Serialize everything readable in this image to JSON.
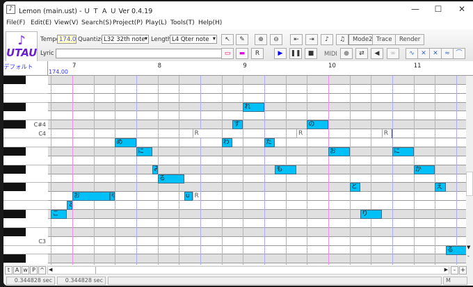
{
  "window": {
    "title": "Lemon (main.ust) - Ｕ Ｔ Ａ Ｕ Ver 0.4.19",
    "minimize": "—",
    "maximize": "☐",
    "close": "✕"
  },
  "menu": [
    "File(F)",
    "Edit(E)",
    "View(V)",
    "Search(S)",
    "Project(P)",
    "Play(L)",
    "Tools(T)",
    "Help(H)"
  ],
  "toolbar": {
    "logo_text": "UTAU",
    "tempo_label": "Tempo",
    "tempo_value": "174.0",
    "quantize_label": "Quantize",
    "quantize_value": "L32 32th note",
    "length_label": "Length",
    "length_value": "L4  Qter note",
    "lyric_label": "Lyric",
    "lyric_value": "",
    "mode2": "Mode2",
    "trace": "Trace",
    "render": "Render",
    "midi_label": "MIDI"
  },
  "track": {
    "name": "デフォルト",
    "tempo": "174.00",
    "measures": [
      "7",
      "8",
      "9",
      "10",
      "11"
    ]
  },
  "key_labels": [
    {
      "row": 5,
      "text": "C#4"
    },
    {
      "row": 6,
      "text": "C4"
    },
    {
      "row": 18,
      "text": "C3"
    }
  ],
  "pitch_rows": [
    "F#4",
    "F4",
    "E4",
    "D#4",
    "D4",
    "C#4",
    "C4",
    "B3",
    "A#3",
    "A3",
    "G#3",
    "G3",
    "F#3",
    "F3",
    "E3",
    "D#3",
    "D3",
    "C#3",
    "C3",
    "B2",
    "A#2"
  ],
  "notes": [
    {
      "lyric": "こ",
      "pitch": "D#3",
      "start": -1,
      "len": 0.75
    },
    {
      "lyric": "と",
      "pitch": "E3",
      "start": -0.25,
      "len": 0.25
    },
    {
      "lyric": "お",
      "pitch": "F3",
      "start": 0,
      "len": 1.75
    },
    {
      "lyric": "ゆ",
      "pitch": "F3",
      "start": 1.75,
      "len": 0.25
    },
    {
      "lyric": "め",
      "pitch": "B3",
      "start": 2,
      "len": 1
    },
    {
      "lyric": "に",
      "pitch": "A#3",
      "start": 3,
      "len": 0.75
    },
    {
      "lyric": "み",
      "pitch": "G#3",
      "start": 3.75,
      "len": 0.25
    },
    {
      "lyric": "る",
      "pitch": "G3",
      "start": 4,
      "len": 1.25
    },
    {
      "lyric": "u",
      "pitch": "F3",
      "start": 5.25,
      "len": 0.375
    },
    {
      "lyric": "R",
      "pitch": "F3",
      "start": 5.625,
      "len": 0.3,
      "rest": true
    },
    {
      "lyric": "R",
      "pitch": "C4",
      "start": 5.625,
      "len": 1.375,
      "rest": true
    },
    {
      "lyric": "わ",
      "pitch": "B3",
      "start": 7,
      "len": 0.5
    },
    {
      "lyric": "す",
      "pitch": "C#4",
      "start": 7.5,
      "len": 0.5
    },
    {
      "lyric": "れ",
      "pitch": "D#4",
      "start": 8,
      "len": 1
    },
    {
      "lyric": "た",
      "pitch": "B3",
      "start": 9,
      "len": 0.5
    },
    {
      "lyric": "も",
      "pitch": "G#3",
      "start": 9.5,
      "len": 1
    },
    {
      "lyric": "R",
      "pitch": "C4",
      "start": 10.5,
      "len": 0.5,
      "rest": true
    },
    {
      "lyric": "の",
      "pitch": "C#4",
      "start": 11,
      "len": 1
    },
    {
      "lyric": "お",
      "pitch": "A#3",
      "start": 12,
      "len": 1
    },
    {
      "lyric": "と",
      "pitch": "F#3",
      "start": 13,
      "len": 0.5
    },
    {
      "lyric": "り",
      "pitch": "D#3",
      "start": 13.5,
      "len": 1
    },
    {
      "lyric": "R",
      "pitch": "C4",
      "start": 14.5,
      "len": 0.5,
      "rest": true
    },
    {
      "lyric": "に",
      "pitch": "A#3",
      "start": 15,
      "len": 1
    },
    {
      "lyric": "か",
      "pitch": "G#3",
      "start": 16,
      "len": 1
    },
    {
      "lyric": "え",
      "pitch": "F#3",
      "start": 17,
      "len": 0.5
    },
    {
      "lyric": "る",
      "pitch": "B2",
      "start": 17.5,
      "len": 1
    }
  ],
  "bottom": {
    "buttons": [
      "t",
      "A",
      "w",
      "P",
      "^"
    ],
    "zoom_minus": "-",
    "zoom_plus": "+"
  },
  "status": {
    "time1": "0.344828 sec",
    "time2": "0.344828 sec",
    "mode": "M"
  },
  "colors": {
    "note": "#00c0f8",
    "measure_line": "#f08cf0",
    "beat_line": "#aaaaff",
    "black_row": "#e0e0e0"
  }
}
